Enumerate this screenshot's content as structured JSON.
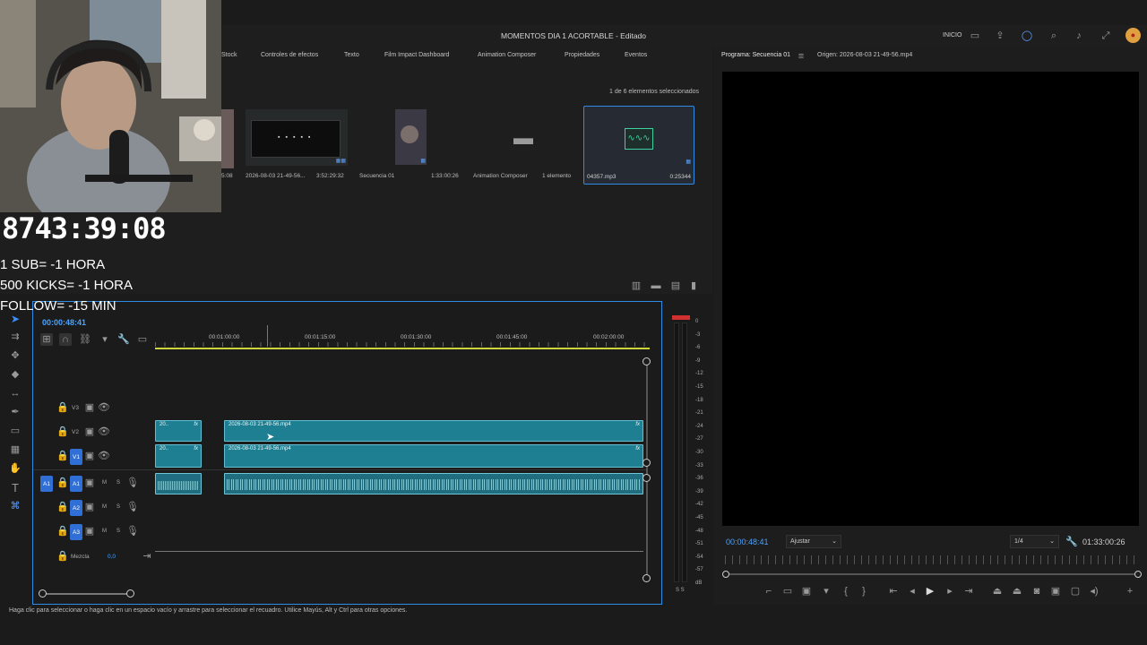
{
  "window": {
    "title": "MOMENTOS DIA 1 ACORTABLE - Editado",
    "workspace": "INICIO"
  },
  "project_tabs": [
    "Stock",
    "Controles de efectos",
    "Texto",
    "Film Impact Dashboard",
    "Animation Composer",
    "Propiedades",
    "Eventos"
  ],
  "project": {
    "selection": "1 de 6 elementos seleccionados",
    "items": [
      {
        "name": "5:08",
        "duration": ""
      },
      {
        "name": "2026-08-03 21-49-56...",
        "duration": "3:52:29:32"
      },
      {
        "name": "Secuencia 01",
        "duration": "1:33:00:26"
      },
      {
        "name": "Animation Composer",
        "duration": "1 elemento"
      },
      {
        "name": "04357.mp3",
        "duration": "0:25344"
      }
    ]
  },
  "program": {
    "tab_program": "Programa: Secuencia 01",
    "tab_source": "Origen: 2026-08-03 21-49-56.mp4",
    "timecode": "00:00:48:41",
    "fit": "Ajustar",
    "resolution": "1/4",
    "duration": "01:33:00:26"
  },
  "timeline": {
    "timecode": "00:00:48:41",
    "ruler": [
      "00:01:00:00",
      "00:01:15:00",
      "00:01:30:00",
      "00:01:45:00",
      "00:02:00:00"
    ],
    "tracks": {
      "v3": "V3",
      "v2": "V2",
      "v1": "V1",
      "a1": "A1",
      "a2": "A2",
      "a3": "A3",
      "mix": "Mezcla",
      "mix_value": "0,0",
      "src_a1": "A1",
      "m": "M",
      "s": "S"
    },
    "clip_name": "2026-08-03 21-49-56.mp4",
    "clip_short": "20..",
    "fx": "fx"
  },
  "meter": {
    "labels": [
      "0",
      "-3",
      "-6",
      "-9",
      "-12",
      "-15",
      "-18",
      "-21",
      "-24",
      "-27",
      "-30",
      "-33",
      "-36",
      "-39",
      "-42",
      "-45",
      "-48",
      "-51",
      "-54",
      "-57",
      "dB"
    ],
    "solo": "S  S"
  },
  "status": "Haga clic para seleccionar o haga clic en un espacio vacío y arrastre para seleccionar el recuadro. Utilice Mayús, Alt y Ctrl para otras opciones.",
  "overlay": {
    "timer": "8743:39:08",
    "line1": "1 SUB= -1 HORA",
    "line2": "500 KICKS= -1 HORA",
    "line3": "FOLLOW= -15 MIN"
  },
  "colors": {
    "accent": "#2e8ce6",
    "clip": "#2a8a9c",
    "audio_wave": "#6fd0dc"
  }
}
